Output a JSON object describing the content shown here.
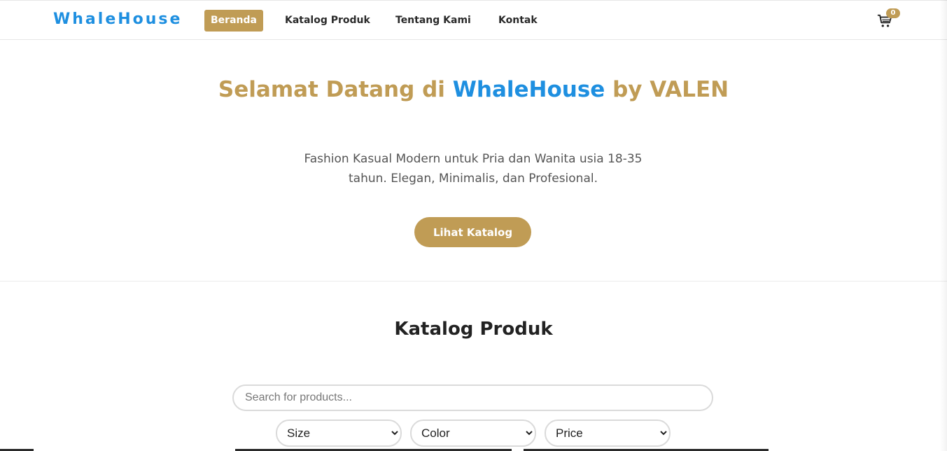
{
  "brand": "WhaleHouse",
  "nav": {
    "items": [
      {
        "label": "Beranda",
        "active": true
      },
      {
        "label": "Katalog Produk",
        "active": false
      },
      {
        "label": "Tentang Kami",
        "active": false
      },
      {
        "label": "Kontak",
        "active": false
      }
    ]
  },
  "cart": {
    "icon": "cart-icon",
    "count": "0"
  },
  "hero": {
    "title_part1": "Selamat Datang di ",
    "title_highlight": "WhaleHouse",
    "title_part2": " by VALEN",
    "description": "Fashion Kasual Modern untuk Pria dan Wanita usia 18-35 tahun. Elegan, Minimalis, dan Profesional.",
    "cta_label": "Lihat Katalog"
  },
  "catalog": {
    "title": "Katalog Produk",
    "search_placeholder": "Search for products...",
    "filters": [
      {
        "selected": "Size"
      },
      {
        "selected": "Color"
      },
      {
        "selected": "Price"
      }
    ]
  },
  "colors": {
    "accent_gold": "#c09c55",
    "brand_blue": "#1e8fe0"
  }
}
